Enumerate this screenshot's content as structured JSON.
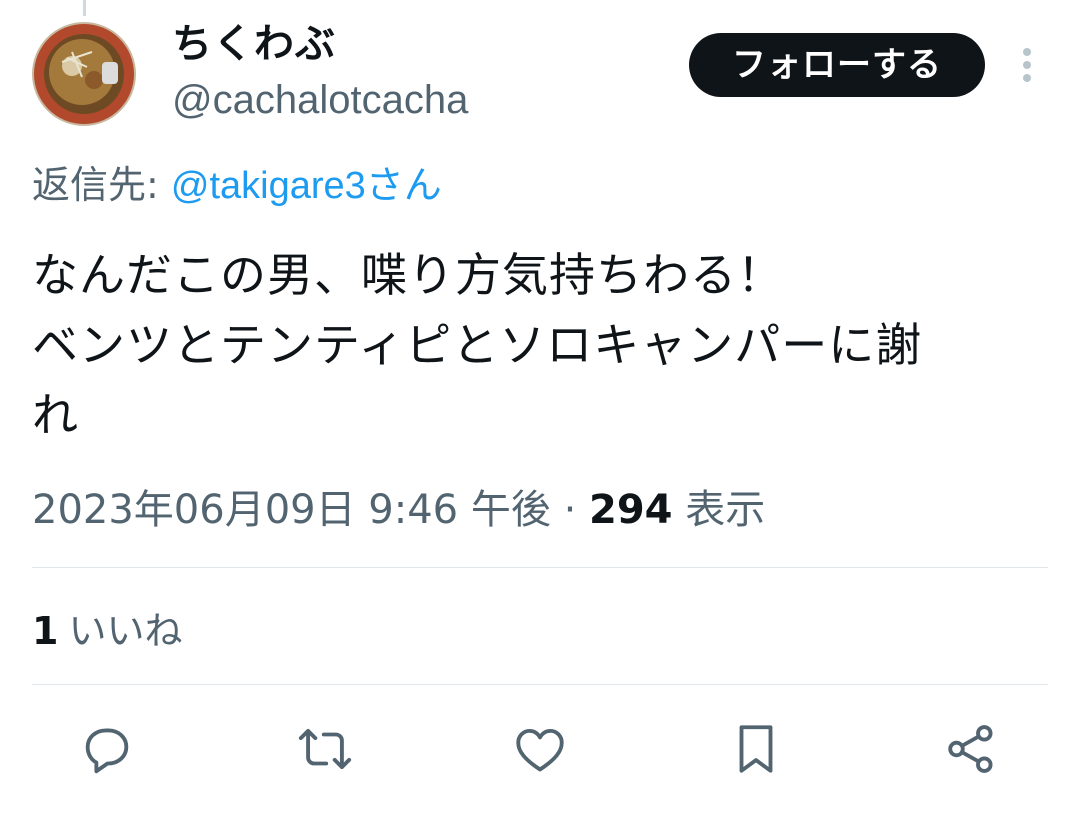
{
  "author": {
    "display_name": "ちくわぶ",
    "handle": "@cachalotcacha"
  },
  "follow_button_label": "フォローする",
  "reply_to": {
    "prefix": "返信先: ",
    "mention": "@takigare3さん"
  },
  "tweet": {
    "lines": [
      "なんだこの男、喋り方気持ちわる！",
      "ベンツとテンティピとソロキャンパーに謝",
      "れ"
    ]
  },
  "meta": {
    "timestamp": "2023年06月09日 9:46 午後",
    "separator": " · ",
    "views_count": "294",
    "views_label": " 表示"
  },
  "likes": {
    "count": "1",
    "label": "いいね"
  },
  "actions": [
    {
      "icon": "reply-icon"
    },
    {
      "icon": "retweet-icon"
    },
    {
      "icon": "like-icon"
    },
    {
      "icon": "bookmark-icon"
    },
    {
      "icon": "share-icon"
    }
  ],
  "colors": {
    "text_primary": "#0f1419",
    "text_secondary": "#536471",
    "link": "#1d9bf0",
    "follow_button_bg": "#0f1419",
    "divider": "#e1e6ea"
  }
}
